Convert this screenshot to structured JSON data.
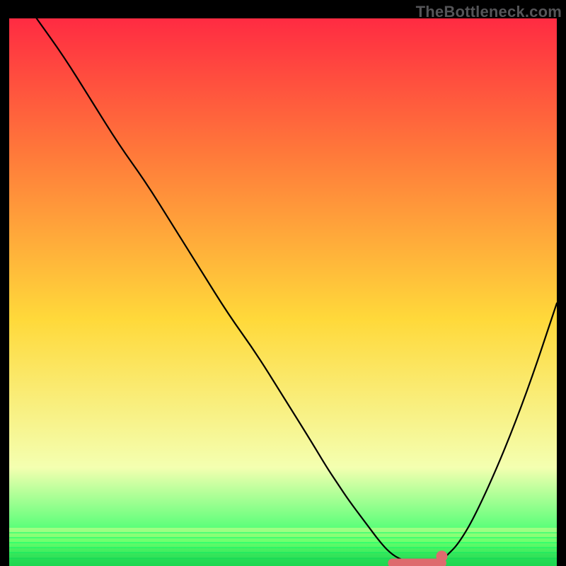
{
  "watermark": "TheBottleneck.com",
  "colors": {
    "background": "#000000",
    "gradient_top": "#ff2b42",
    "gradient_mid": "#ffd93a",
    "gradient_bottom": "#33ff6b",
    "curve": "#000000",
    "marker_stroke": "#de6b6e",
    "marker_fill": "#de6b6e",
    "watermark": "#555558"
  },
  "chart_data": {
    "type": "line",
    "title": "",
    "xlabel": "",
    "ylabel": "",
    "xlim": [
      0,
      100
    ],
    "ylim": [
      0,
      100
    ],
    "series": [
      {
        "name": "bottleneck-curve",
        "x": [
          5,
          10,
          15,
          20,
          25,
          30,
          35,
          40,
          45,
          50,
          55,
          58,
          60,
          62,
          65,
          68,
          70,
          72,
          74,
          76,
          78,
          80,
          82,
          85,
          90,
          95,
          100
        ],
        "y": [
          100,
          93,
          85,
          77,
          70,
          62,
          54,
          46,
          39,
          31,
          23,
          18,
          15,
          12,
          8,
          4,
          2,
          1,
          0,
          0,
          0,
          2,
          4,
          9,
          20,
          33,
          48
        ]
      }
    ],
    "markers": [
      {
        "name": "flat-segment",
        "x_start": 70,
        "x_end": 79,
        "y": 0
      },
      {
        "name": "end-dot",
        "x": 79,
        "y": 1
      }
    ]
  }
}
